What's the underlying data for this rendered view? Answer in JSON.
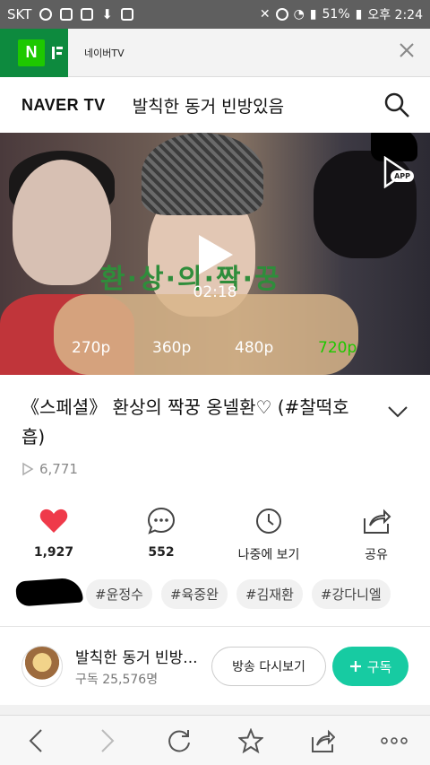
{
  "status_bar": {
    "carrier": "SKT",
    "battery": "51%",
    "time": "오후 2:24"
  },
  "tab": {
    "logo_letter": "N",
    "title": "네이버TV"
  },
  "header": {
    "logo": "NAVER TV",
    "title": "발칙한 동거 빈방있음"
  },
  "video": {
    "overlay_text": "환·상·의·짝·꿍",
    "duration": "02:18",
    "qualities": [
      "270p",
      "360p",
      "480p",
      "720p"
    ],
    "selected_quality": "720p",
    "app_label": "APP"
  },
  "info": {
    "title": "《스페셜》 환상의 짝꿍 옹넬환♡ (#찰떡호흡)",
    "views": "6,771"
  },
  "actions": [
    {
      "label": "1,927",
      "icon": "heart-icon"
    },
    {
      "label": "552",
      "icon": "comment-icon"
    },
    {
      "label": "나중에 보기",
      "icon": "clock-icon"
    },
    {
      "label": "공유",
      "icon": "share-icon"
    }
  ],
  "tags": [
    "#윤정수",
    "#육중완",
    "#김재환",
    "#강다니엘"
  ],
  "channel": {
    "name": "발칙한 동거 빈방...",
    "subscribers": "구독 25,576명",
    "replay_label": "방송 다시보기",
    "subscribe_label": "구독"
  },
  "colors": {
    "naver_green": "#1ec800",
    "subscribe": "#17cba2",
    "like_red": "#ef3a4a"
  }
}
